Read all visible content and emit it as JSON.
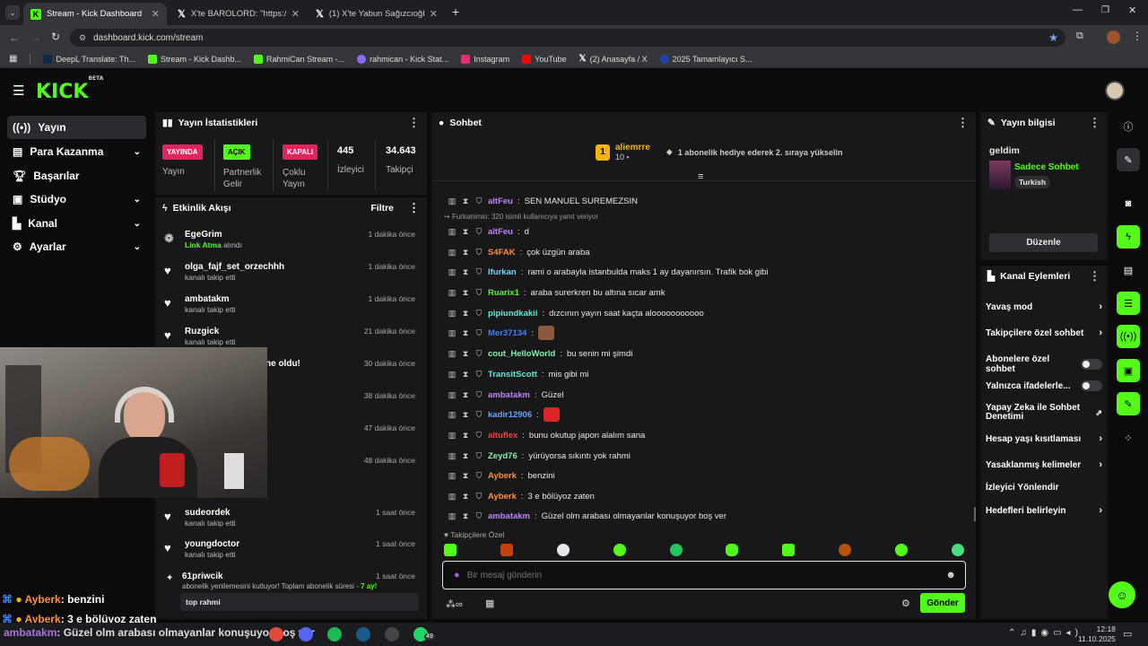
{
  "browser": {
    "tabs": [
      {
        "title": "Stream - Kick Dashboard",
        "favicon": "kick-icon"
      },
      {
        "title": "X'te BAROLORD: \"https://t.co/w",
        "favicon": "x-icon"
      },
      {
        "title": "(1) X'te Yabun Sağızcıoğlu: \"",
        "favicon": "x-icon"
      }
    ],
    "url": "dashboard.kick.com/stream",
    "bookmarks": [
      {
        "label": "DeepL Translate: Th...",
        "color": "#0f2b46"
      },
      {
        "label": "Stream - Kick Dashb...",
        "color": "#53fc18"
      },
      {
        "label": "RahmiCan Stream -...",
        "color": "#53fc18"
      },
      {
        "label": "rahmican - Kick Stat...",
        "color": "#8a6cff"
      },
      {
        "label": "Instagram",
        "color": "#e1306c"
      },
      {
        "label": "YouTube",
        "color": "#ff0000"
      },
      {
        "label": "(2) Anasayfa / X",
        "color": "#111111"
      },
      {
        "label": "2025 Tamamlayıcı S...",
        "color": "#2244aa"
      }
    ]
  },
  "app": {
    "logo": "KICK",
    "logo_beta": "BETA"
  },
  "sidebar": [
    {
      "label": "Yayın",
      "icon": "broadcast-icon",
      "active": true,
      "chevron": false
    },
    {
      "label": "Para Kazanma",
      "icon": "money-icon",
      "active": false,
      "chevron": true
    },
    {
      "label": "Başarılar",
      "icon": "trophy-icon",
      "active": false,
      "chevron": false
    },
    {
      "label": "Stüdyo",
      "icon": "studio-icon",
      "active": false,
      "chevron": true
    },
    {
      "label": "Kanal",
      "icon": "channel-icon",
      "active": false,
      "chevron": true
    },
    {
      "label": "Ayarlar",
      "icon": "gear-icon",
      "active": false,
      "chevron": true
    }
  ],
  "stats": {
    "title": "Yayın İstatistikleri",
    "items": [
      {
        "badge": "YAYINDA",
        "badge_color": "#e0245e",
        "label": "Yayın"
      },
      {
        "badge": "AÇIK",
        "badge_color": "#53fc18",
        "label": "Partnerlik Gelir"
      },
      {
        "badge": "KAPALI",
        "badge_color": "#e0245e",
        "label": "Çoklu Yayın"
      },
      {
        "value": "445",
        "label": "İzleyici"
      },
      {
        "value": "34.643",
        "label": "Takipçi"
      }
    ]
  },
  "activity": {
    "title": "Etkinlik Akışı",
    "filter": "Filtre",
    "items": [
      {
        "name": "EgeGrim",
        "sub_highlight": "Link Atma",
        "sub": "alındı",
        "time": "1 dakika önce",
        "icon": "gift-icon"
      },
      {
        "name": "olga_fajf_set_orzechhh",
        "sub": "kanalı takip etti",
        "time": "1 dakika önce",
        "icon": "heart-icon"
      },
      {
        "name": "ambatakm",
        "sub": "kanalı takip etti",
        "time": "1 dakika önce",
        "icon": "heart-icon"
      },
      {
        "name": "Ruzgick",
        "sub": "kanalı takip etti",
        "time": "21 dakika önce",
        "icon": "heart-icon"
      },
      {
        "name": "he oldu!",
        "sub": "",
        "time": "30 dakika önce",
        "icon": ""
      },
      {
        "name": "",
        "sub": "",
        "time": "38 dakika önce",
        "icon": ""
      },
      {
        "name": "",
        "sub": "",
        "time": "47 dakika önce",
        "icon": ""
      },
      {
        "name": "",
        "sub": "",
        "time": "48 dakika önce",
        "icon": ""
      },
      {
        "name": "sudeordek",
        "sub": "kanalı takip etti",
        "time": "1 saat önce",
        "icon": "heart-icon"
      },
      {
        "name": "youngdoctor",
        "sub": "kanalı takip etti",
        "time": "1 saat önce",
        "icon": "heart-icon"
      },
      {
        "name": "61priwcik",
        "sub": "abonelik yenilemesini kutluyor! Toplam abonelik süresi - ",
        "sub_highlight": "7 ay!",
        "time": "1 saat önce",
        "icon": "star-icon"
      }
    ],
    "note": "top rahmi"
  },
  "chat": {
    "title": "Sohbet",
    "pinned_user": "aliemrre",
    "pinned_rank": "1",
    "pinned_count": "10",
    "pinned_text": "1 abonelik hediye ederek 2. sıraya yükselin",
    "reply_notice": "Furkanimio: 320 isimli kullanıcıya yanıt veriyor",
    "messages": [
      {
        "user": "altFeu",
        "color": "#c084fc",
        "text": "SEN MANUEL SUREMEZSIN"
      },
      {
        "user": "altFeu",
        "color": "#c084fc",
        "text": "d"
      },
      {
        "user": "S4FAK",
        "color": "#ff8a3d",
        "text": "çok üzgün araba"
      },
      {
        "user": "Ifurkan",
        "color": "#7dd3fc",
        "text": "rami o arabayla istanbulda maks 1 ay dayanırsın. Trafik bok gibi"
      },
      {
        "user": "Ruarix1",
        "color": "#53fc18",
        "text": "araba surerkren bu altına sıcar amk"
      },
      {
        "user": "pipiundkakii",
        "color": "#5eead4",
        "text": "dızcının yayın saat kaçta alooooooooooo"
      },
      {
        "user": "Mer37134",
        "color": "#3b82f6",
        "text": ""
      },
      {
        "user": "cout_HelloWorld",
        "color": "#86efac",
        "text": "bu senin mi şimdi"
      },
      {
        "user": "TransitScott",
        "color": "#5eead4",
        "text": "mis gibi mi"
      },
      {
        "user": "ambatakm",
        "color": "#c084fc",
        "text": "Güzel"
      },
      {
        "user": "kadir12906",
        "color": "#60a5fa",
        "text": ""
      },
      {
        "user": "altuflex",
        "color": "#ef4444",
        "text": "bunu okutup japon alalım sana"
      },
      {
        "user": "Zeyd76",
        "color": "#86efac",
        "text": "yürüyorsa sıkıntı yok rahmi"
      },
      {
        "user": "Ayberk",
        "color": "#fb923c",
        "text": "benzini"
      },
      {
        "user": "Ayberk",
        "color": "#fb923c",
        "text": "3 e bölüyoz zaten"
      },
      {
        "user": "ambatakm",
        "color": "#c084fc",
        "text": "Güzel olm arabası olmayanlar konuşuyor boş ver"
      }
    ],
    "followers_only": "Takipçilere Özel",
    "input_placeholder": "Bir mesaj gönderin",
    "send": "Gönder"
  },
  "stream_info": {
    "title": "Yayın bilgisi",
    "stream_title": "geldim",
    "category": "Sadece Sohbet",
    "language": "Turkish",
    "edit": "Düzenle"
  },
  "channel_actions": {
    "title": "Kanal Eylemleri",
    "items": [
      {
        "label": "Yavaş mod",
        "kind": "chevron"
      },
      {
        "label": "Takipçilere özel sohbet",
        "kind": "chevron"
      },
      {
        "label": "Abonelere özel sohbet",
        "kind": "toggle"
      },
      {
        "label": "Yalnızca ifadelerle...",
        "kind": "toggle"
      },
      {
        "label": "Yapay Zeka ile Sohbet Denetimi",
        "kind": "external"
      },
      {
        "label": "Hesap yaşı kısıtlaması",
        "kind": "chevron"
      },
      {
        "label": "Yasaklanmış kelimeler",
        "kind": "chevron"
      },
      {
        "label": "İzleyici Yönlendir",
        "kind": "none"
      },
      {
        "label": "Hedefleri belirleyin",
        "kind": "chevron"
      }
    ]
  },
  "overlay": {
    "lines": [
      {
        "user": "Ayberk",
        "text": ": benzini"
      },
      {
        "user": "Ayberk",
        "text": ": 3 e bölüyoz zaten"
      },
      {
        "user": "ambatakm",
        "text": ": Güzel olm arabası olmayanlar konuşuyor boş ver"
      }
    ]
  },
  "taskbar": {
    "time": "12:18",
    "date": "11.10.2025",
    "whatsapp_badge": "49"
  }
}
